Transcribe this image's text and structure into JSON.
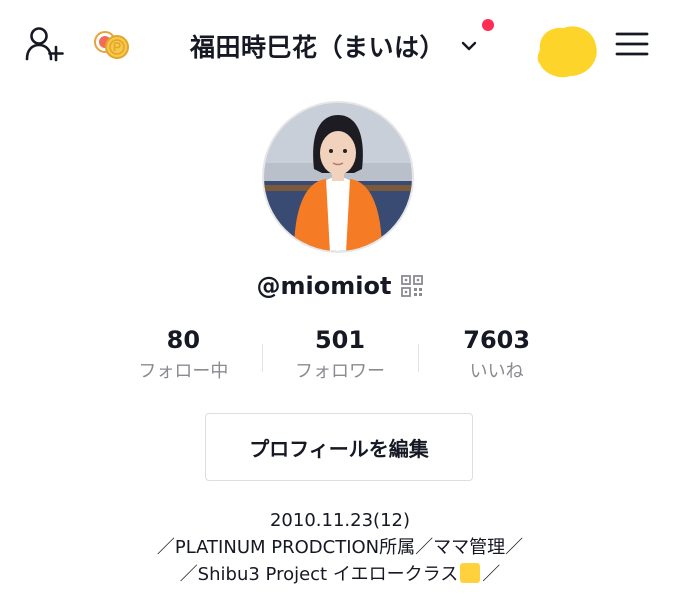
{
  "header": {
    "title": "福田時巳花（まいは）",
    "icons": [
      "add-user-icon",
      "coin-icon",
      "chevron-down-icon",
      "notification-dot",
      "sticker-blob",
      "menu-icon"
    ],
    "dot_color": "#fe2c55",
    "blob_color": "#fdd52a"
  },
  "profile": {
    "handle": "@miomiot",
    "qr_icon": "qr-code-icon"
  },
  "stats": [
    {
      "value": "80",
      "label": "フォロー中"
    },
    {
      "value": "501",
      "label": "フォロワー"
    },
    {
      "value": "7603",
      "label": "いいね"
    }
  ],
  "edit_button": {
    "label": "プロフィールを編集"
  },
  "bio": {
    "line1": "2010.11.23(12)",
    "line2": "／PLATINUM PRODCTION所属／ママ管理／",
    "line3_a": "／Shibu3 Project イエロークラス",
    "line3_b": "／"
  },
  "colors": {
    "accent_yellow": "#ffd23d",
    "secondary_text": "#8a8b91"
  }
}
